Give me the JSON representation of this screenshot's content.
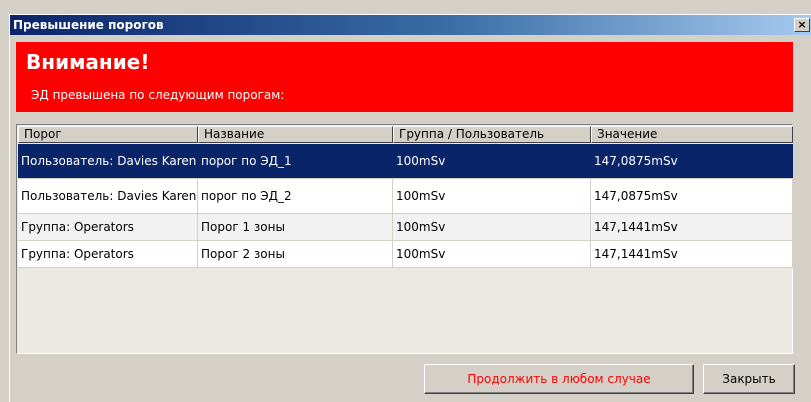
{
  "window": {
    "title": "Превышение порогов",
    "close_glyph": "×"
  },
  "banner": {
    "title": "Внимание!",
    "message": "ЭД превышена по следующим порогам:",
    "color": "#ff0000"
  },
  "table": {
    "columns": [
      "Порог",
      "Название",
      "Группа / Пользователь",
      "Значение"
    ],
    "rows": [
      {
        "threshold": "Пользователь: Davies Karen",
        "name": "порог по ЭД_1",
        "group": "100mSv",
        "value": "147,0875mSv",
        "selected": true
      },
      {
        "threshold": "Пользователь: Davies Karen",
        "name": "порог по ЭД_2",
        "group": "100mSv",
        "value": "147,0875mSv",
        "selected": false
      },
      {
        "threshold": "Группа: Operators",
        "name": "Порог 1 зоны",
        "group": "100mSv",
        "value": "147,1441mSv",
        "selected": false
      },
      {
        "threshold": "Группа: Operators",
        "name": "Порог 2 зоны",
        "group": "100mSv",
        "value": "147,1441mSv",
        "selected": false
      }
    ]
  },
  "buttons": {
    "continue_label": "Продолжить в любом случае",
    "close_label": "Закрыть"
  },
  "colors": {
    "selection": "#0a246a",
    "warning": "#ff0000"
  }
}
